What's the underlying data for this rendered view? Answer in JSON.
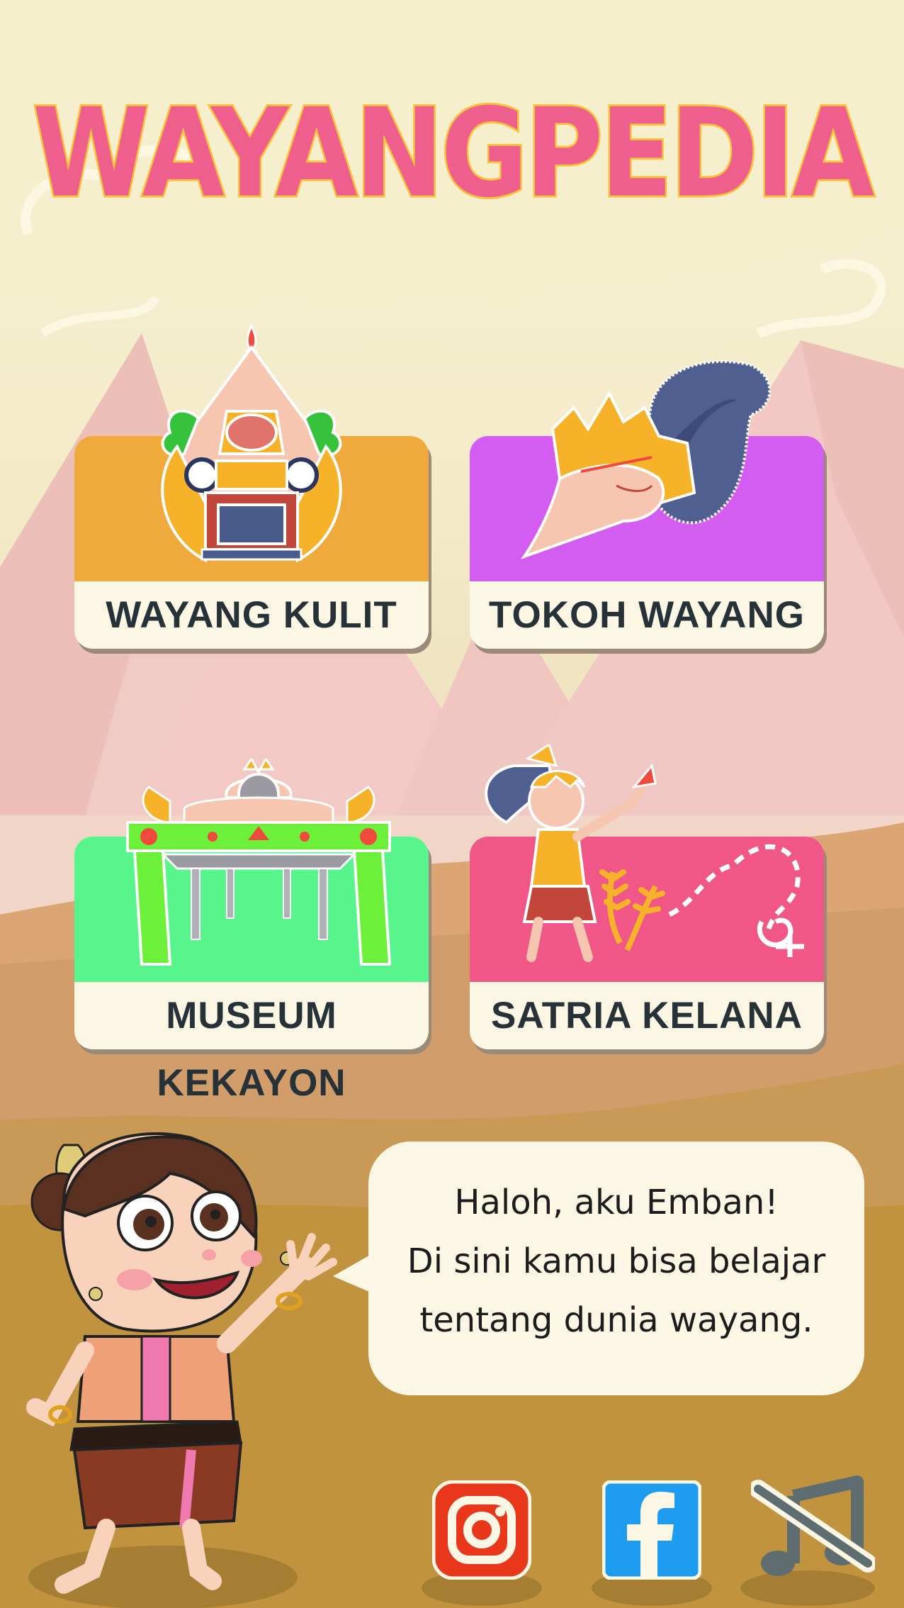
{
  "app": {
    "title": "WAYANGPEDIA"
  },
  "menu": {
    "items": [
      {
        "label": "WAYANG KULIT",
        "color": "#f0aa3c"
      },
      {
        "label": "TOKOH WAYANG",
        "color": "#d35df0"
      },
      {
        "label": "MUSEUM KEKAYON",
        "color": "#58f58c"
      },
      {
        "label": "SATRIA KELANA",
        "color": "#f05686"
      }
    ]
  },
  "guide": {
    "lines": [
      "Haloh, aku Emban!",
      "Di sini kamu bisa belajar",
      "tentang dunia wayang."
    ]
  },
  "social": {
    "instagram_icon": "instagram-icon",
    "facebook_icon": "facebook-icon",
    "music_icon": "music-muted-icon"
  },
  "colors": {
    "title": "#ef5f8e",
    "title_outline": "#f8c23a",
    "label_text": "#263238"
  }
}
